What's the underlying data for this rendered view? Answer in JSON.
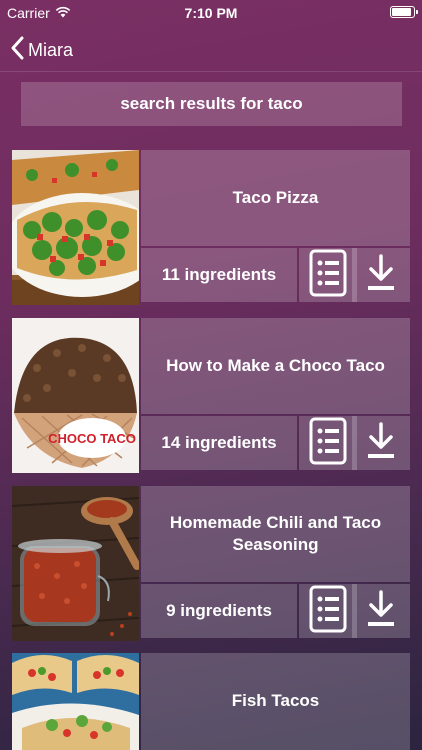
{
  "status_bar": {
    "carrier": "Carrier",
    "time": "7:10 PM",
    "battery_level": 0.9
  },
  "nav": {
    "back_label": "Miara"
  },
  "search": {
    "label": "search results for taco"
  },
  "results": [
    {
      "title": "Taco Pizza",
      "ingredients": "11 ingredients"
    },
    {
      "title": "How to Make a Choco Taco",
      "ingredients": "14 ingredients"
    },
    {
      "title": "Homemade Chili and Taco Seasoning",
      "ingredients": "9 ingredients"
    },
    {
      "title": "Fish Tacos",
      "ingredients": ""
    }
  ],
  "thumbnail_logo_text": "CHOCO TACO"
}
